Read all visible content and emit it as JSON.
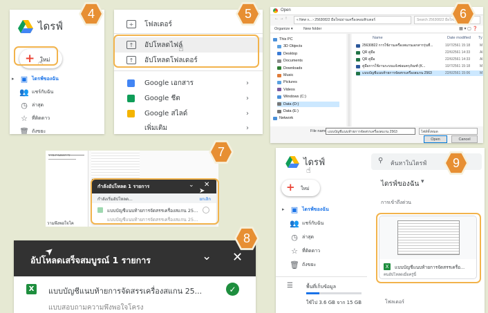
{
  "steps": [
    "4",
    "5",
    "6",
    "7",
    "8",
    "9"
  ],
  "panel1": {
    "title": "ไดรฟ์",
    "new_label": "ใหม่",
    "items": [
      {
        "icon": "my-drive-icon",
        "glyph": "▣",
        "label": "ไดรฟ์ของฉัน",
        "active": true
      },
      {
        "icon": "shared-icon",
        "glyph": "👥",
        "label": "แชร์กับฉัน"
      },
      {
        "icon": "recent-icon",
        "glyph": "◷",
        "label": "ล่าสุด"
      },
      {
        "icon": "star-icon",
        "glyph": "☆",
        "label": "ที่ติดดาว"
      },
      {
        "icon": "trash-icon",
        "glyph": "🗑",
        "label": "ถังขยะ"
      }
    ]
  },
  "panel2": {
    "folder_label": "โฟลเดอร์",
    "upload_file_label": "อัปโหลดไฟล์",
    "upload_folder_label": "อัปโหลดโฟลเดอร์",
    "apps": [
      {
        "label": "Google เอกสาร",
        "color": "#4285f4"
      },
      {
        "label": "Google ชีต",
        "color": "#0f9d58"
      },
      {
        "label": "Google สไลด์",
        "color": "#f4b400"
      }
    ],
    "more_label": "เพิ่มเติม"
  },
  "panel3": {
    "window_title": "Open",
    "address": "« New v... › 25630822 มือใหม่อ่านเครื่องคอมพิวเตอร์",
    "search_placeholder": "Search 25630822 มือใหม่...",
    "organize_label": "Organize ▾",
    "new_folder_label": "New folder",
    "col_name": "Name",
    "col_date": "Date modified",
    "col_type": "Ty",
    "tree": [
      {
        "label": "This PC",
        "color": "#4a90d9"
      },
      {
        "label": "3D Objects",
        "color": "#5aa0e0"
      },
      {
        "label": "Desktop",
        "color": "#3a7bd5"
      },
      {
        "label": "Documents",
        "color": "#8a8a8a"
      },
      {
        "label": "Downloads",
        "color": "#2e7d32"
      },
      {
        "label": "Music",
        "color": "#e07b39"
      },
      {
        "label": "Pictures",
        "color": "#5aa0e0"
      },
      {
        "label": "Videos",
        "color": "#7b5aa0"
      },
      {
        "label": "Windows (C:)",
        "color": "#4a90d9"
      },
      {
        "label": "Data (D:)",
        "color": "#777777"
      },
      {
        "label": "Data (E:)",
        "color": "#777777"
      },
      {
        "label": "Network",
        "color": "#4a90d9"
      }
    ],
    "files": [
      {
        "name": "25630822 การใช้งานเครื่องสแกนเอกสารรุ่นที่...",
        "date": "10/7/2561 15:18",
        "type": "M",
        "color": "#2b579a"
      },
      {
        "name": "QR คู่มือ",
        "date": "22/6/2561 14:33",
        "type": "Al",
        "color": "#217346"
      },
      {
        "name": "QR คู่มือ",
        "date": "22/6/2561 14:33",
        "type": "Al",
        "color": "#217346"
      },
      {
        "name": "คู่มือการใช้งานระบบแจ้งซ่อมครุภัณฑ์ (K...",
        "date": "10/7/2561 15:18",
        "type": "M",
        "color": "#2b579a"
      },
      {
        "name": "แบบบัญชีแนบท้ายการจัดสรรเครื่องสแกน 2563",
        "date": "22/6/2561 15:06",
        "type": "M",
        "color": "#217346",
        "selected": true
      }
    ],
    "filename_label": "File name:",
    "filename_value": "แบบบัญชีแนบท้ายการจัดสรรเครื่องสแกน 2563",
    "filetype_value": "ไฟล์ทั้งหมด",
    "open_label": "Open",
    "cancel_label": "Cancel"
  },
  "panel7": {
    "header": "กำลังอัปโหลด 1 รายการ",
    "status": "กำลังเริ่มอัปโหลด...",
    "cancel": "ยกเลิก",
    "file": "แบบบัญชีแนบท้ายการจัดสรรเครื่องสแกน 25...",
    "file2": "แบบบัญชีแนบท้ายการจัดสรรเครื่องสแกน 25...",
    "bg_text": "รายงานผลการ",
    "bg_text2": "วามพึงพอใจโค"
  },
  "panel8": {
    "header": "อัปโหลดเสร็จสมบูรณ์ 1 รายการ",
    "file": "แบบบัญชีแนบท้ายการจัดสรรเครื่องสแกน 25...",
    "bottom_text": "แบบสอบถามความพึงพอใจโครง"
  },
  "panel9": {
    "title": "ไดรฟ์",
    "search_placeholder": "ค้นหาในไดรฟ์",
    "new_label": "ใหม่",
    "heading": "ไดรฟ์ของฉัน",
    "quick_access": "การเข้าถึงด่วน",
    "items": [
      {
        "icon": "my-drive-icon",
        "glyph": "▣",
        "label": "ไดรฟ์ของฉัน",
        "active": true
      },
      {
        "icon": "shared-icon",
        "glyph": "👥",
        "label": "แชร์กับฉัน"
      },
      {
        "icon": "recent-icon",
        "glyph": "◷",
        "label": "ล่าสุด"
      },
      {
        "icon": "star-icon",
        "glyph": "☆",
        "label": "ที่ติดดาว"
      },
      {
        "icon": "trash-icon",
        "glyph": "🗑",
        "label": "ถังขยะ"
      }
    ],
    "storage_label": "พื้นที่เก็บข้อมูล",
    "storage_used": "ใช้ไป 3.6 GB จาก 15 GB",
    "storage_fraction": 0.24,
    "card_name": "แบบบัญชีแนบท้ายการจัดสรรเครื่อ...",
    "card_sub": "คนอัปโหลดเมื่อครู่นี้",
    "folders_label": "โฟลเดอร์"
  }
}
